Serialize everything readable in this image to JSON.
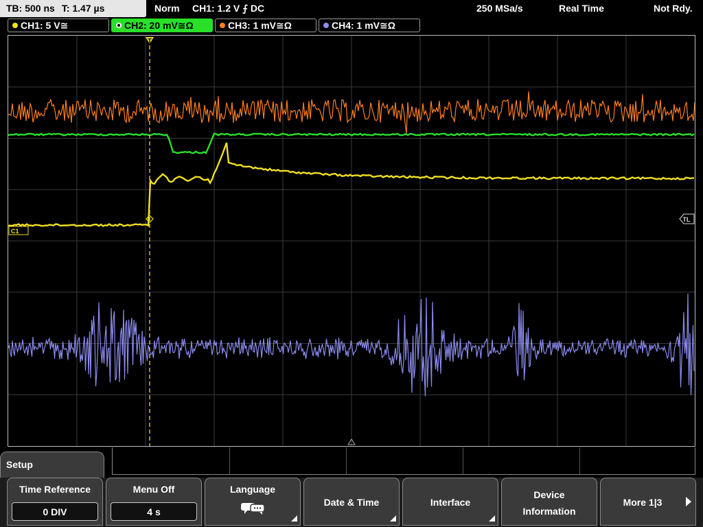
{
  "topbar": {
    "timebase": "TB: 500 ns",
    "trigger_time": "T: 1.47 µs",
    "mode": "Norm",
    "trigger": "CH1: 1.2 V ⨍ DC",
    "sample_rate": "250 MSa/s",
    "acquisition": "Real Time",
    "status": "Not Rdy."
  },
  "channels": [
    {
      "label": "CH1: 5 V≅",
      "color": "#f0e020",
      "active": false
    },
    {
      "label": "CH2: 20 mV≅Ω",
      "color": "#28e028",
      "active": true
    },
    {
      "label": "CH3: 1 mV≅Ω",
      "color": "#ff8020",
      "active": false
    },
    {
      "label": "CH4: 1 mV≅Ω",
      "color": "#8c8cf0",
      "active": false
    }
  ],
  "screen": {
    "trigger_marker": "T",
    "trigger_level_marker": "TL",
    "ch1_marker": "C1"
  },
  "colors": {
    "ch1": "#f0e020",
    "ch2": "#28e028",
    "ch3": "#ff8020",
    "ch4": "#8c8cf0",
    "grid": "#3c3c3c"
  },
  "menu": {
    "title": "Setup",
    "keys": [
      {
        "label": "Time Reference",
        "value": "0 DIV"
      },
      {
        "label": "Menu Off",
        "value": "4 s"
      },
      {
        "label": "Language",
        "icon": "speech-bubbles-icon"
      },
      {
        "label": "Date & Time"
      },
      {
        "label": "Interface"
      },
      {
        "label": "Device",
        "label2": "Information"
      },
      {
        "label": "More 1|3"
      }
    ]
  }
}
